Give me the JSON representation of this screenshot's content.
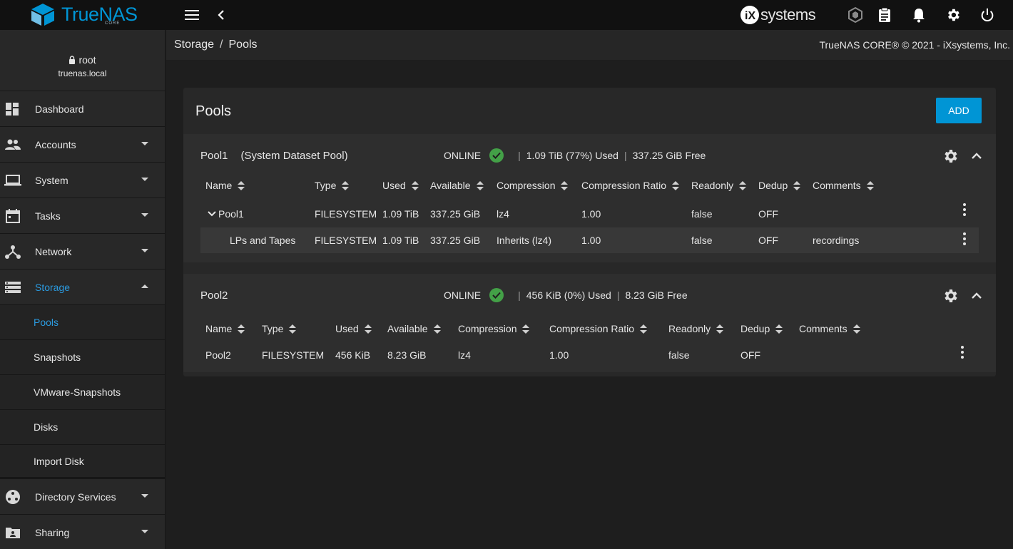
{
  "app": {
    "logo_name": "TrueNAS",
    "logo_sub": "CORE",
    "vendor_brand": "systems"
  },
  "user": {
    "name": "root",
    "host": "truenas.local"
  },
  "sidebar": {
    "items": [
      {
        "label": "Dashboard"
      },
      {
        "label": "Accounts"
      },
      {
        "label": "System"
      },
      {
        "label": "Tasks"
      },
      {
        "label": "Network"
      },
      {
        "label": "Storage"
      },
      {
        "label": "Directory Services"
      },
      {
        "label": "Sharing"
      }
    ],
    "storage_sub": [
      {
        "label": "Pools"
      },
      {
        "label": "Snapshots"
      },
      {
        "label": "VMware-Snapshots"
      },
      {
        "label": "Disks"
      },
      {
        "label": "Import Disk"
      }
    ]
  },
  "breadcrumb": {
    "parent": "Storage",
    "separator": "/",
    "current": "Pools"
  },
  "copyright": "TrueNAS CORE® © 2021 - iXsystems, Inc.",
  "main": {
    "title": "Pools",
    "add_label": "ADD",
    "pools": [
      {
        "name": "Pool1",
        "tag": "(System Dataset Pool)",
        "status": "ONLINE",
        "used": "1.09 TiB (77%) Used",
        "free": "337.25 GiB Free",
        "columns": [
          "Name",
          "Type",
          "Used",
          "Available",
          "Compression",
          "Compression Ratio",
          "Readonly",
          "Dedup",
          "Comments"
        ],
        "rows": [
          {
            "name": "Pool1",
            "type": "FILESYSTEM",
            "used": "1.09 TiB",
            "available": "337.25 GiB",
            "compression": "lz4",
            "ratio": "1.00",
            "readonly": "false",
            "dedup": "OFF",
            "comments": ""
          },
          {
            "name": "LPs and Tapes",
            "type": "FILESYSTEM",
            "used": "1.09 TiB",
            "available": "337.25 GiB",
            "compression": "Inherits (lz4)",
            "ratio": "1.00",
            "readonly": "false",
            "dedup": "OFF",
            "comments": "recordings"
          }
        ]
      },
      {
        "name": "Pool2",
        "tag": "",
        "status": "ONLINE",
        "used": "456 KiB (0%) Used",
        "free": "8.23 GiB Free",
        "columns": [
          "Name",
          "Type",
          "Used",
          "Available",
          "Compression",
          "Compression Ratio",
          "Readonly",
          "Dedup",
          "Comments"
        ],
        "rows": [
          {
            "name": "Pool2",
            "type": "FILESYSTEM",
            "used": "456 KiB",
            "available": "8.23 GiB",
            "compression": "lz4",
            "ratio": "1.00",
            "readonly": "false",
            "dedup": "OFF",
            "comments": ""
          }
        ]
      }
    ]
  },
  "icons": {
    "menu": "menu-icon",
    "back": "chevron-left-icon",
    "truecommand": "truecommand-icon",
    "tasks": "clipboard-icon",
    "alerts": "bell-icon",
    "settings": "gear-icon",
    "power": "power-icon"
  }
}
